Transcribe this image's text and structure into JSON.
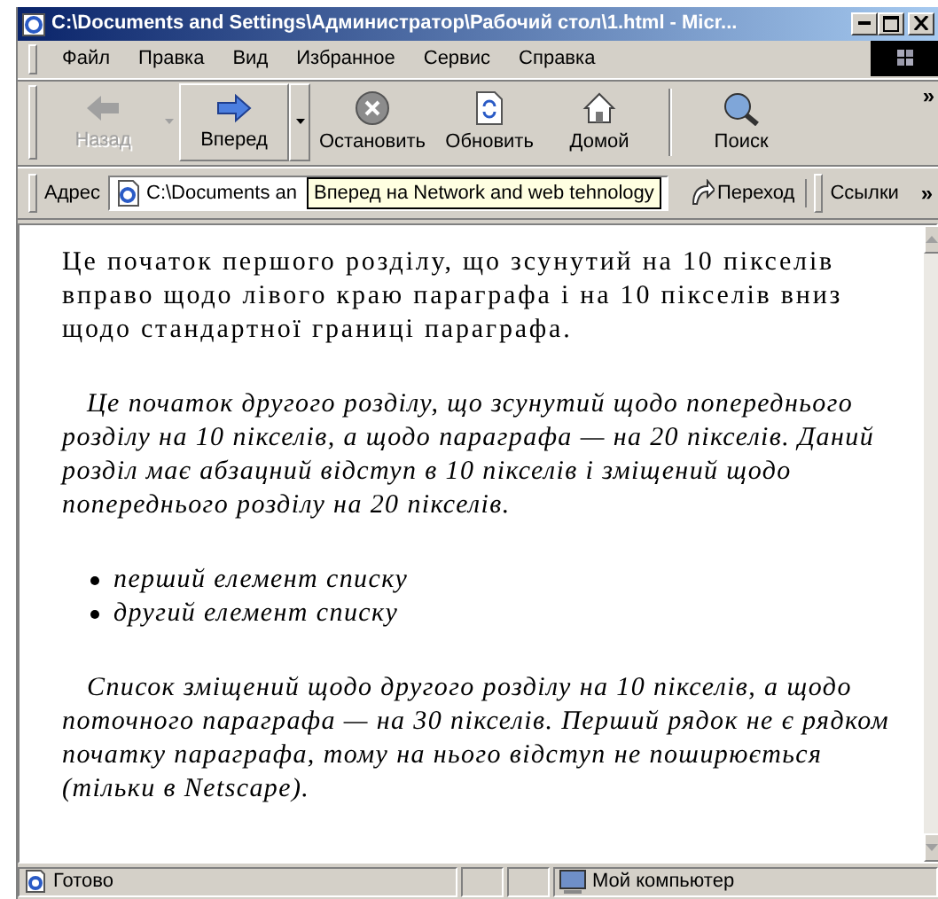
{
  "window": {
    "title": "C:\\Documents and Settings\\Администратор\\Рабочий стол\\1.html - Micr..."
  },
  "menu": [
    "Файл",
    "Правка",
    "Вид",
    "Избранное",
    "Сервис",
    "Справка"
  ],
  "toolbar": {
    "buttons": [
      {
        "label": "Назад",
        "kind": "back",
        "disabled": true,
        "hovered": false,
        "dropdown": true
      },
      {
        "label": "Вперед",
        "kind": "forward",
        "disabled": false,
        "hovered": true,
        "dropdown": true
      },
      {
        "label": "Остановить",
        "kind": "stop",
        "disabled": false,
        "hovered": false,
        "dropdown": false
      },
      {
        "label": "Обновить",
        "kind": "refresh",
        "disabled": false,
        "hovered": false,
        "dropdown": false
      },
      {
        "label": "Домой",
        "kind": "home",
        "disabled": false,
        "hovered": false,
        "dropdown": false
      },
      {
        "label": "Поиск",
        "kind": "search",
        "disabled": false,
        "hovered": false,
        "dropdown": false
      }
    ],
    "more": "»"
  },
  "address_bar": {
    "label": "Адрес",
    "value": "C:\\Documents an",
    "go": "Переход",
    "links": "Ссылки",
    "more": "»"
  },
  "tooltip": "Вперед на Network and web tehnology",
  "content": [
    {
      "kind": "paragraph",
      "italic": false,
      "indent": false,
      "text": "Це початок першого розділу, що зсунутий на 10 пікселів вправо щодо лівого краю параграфа і на 10 пікселів вниз щодо стандартної границі параграфа."
    },
    {
      "kind": "paragraph",
      "italic": true,
      "indent": true,
      "text": "Це початок другого розділу, що зсунутий щодо попереднього розділу на 10 пікселів, а щодо параграфа — на 20 пікселів. Даний розділ має абзацний відступ в 10 пікселів і зміщений щодо попереднього розділу на 20 пікселів."
    },
    {
      "kind": "list",
      "italic": true,
      "items": [
        "перший елемент списку",
        "другий елемент списку"
      ]
    },
    {
      "kind": "paragraph",
      "italic": true,
      "indent": true,
      "text": "Список зміщений щодо другого розділу на 10 пікселів, а щодо поточного параграфа — на 30 пікселів. Перший рядок не є рядком початку параграфа, тому на нього відступ не поширюється (тільки в  Netscape)."
    }
  ],
  "status_bar": {
    "text": "Готово",
    "zone": "Мой компьютер"
  }
}
